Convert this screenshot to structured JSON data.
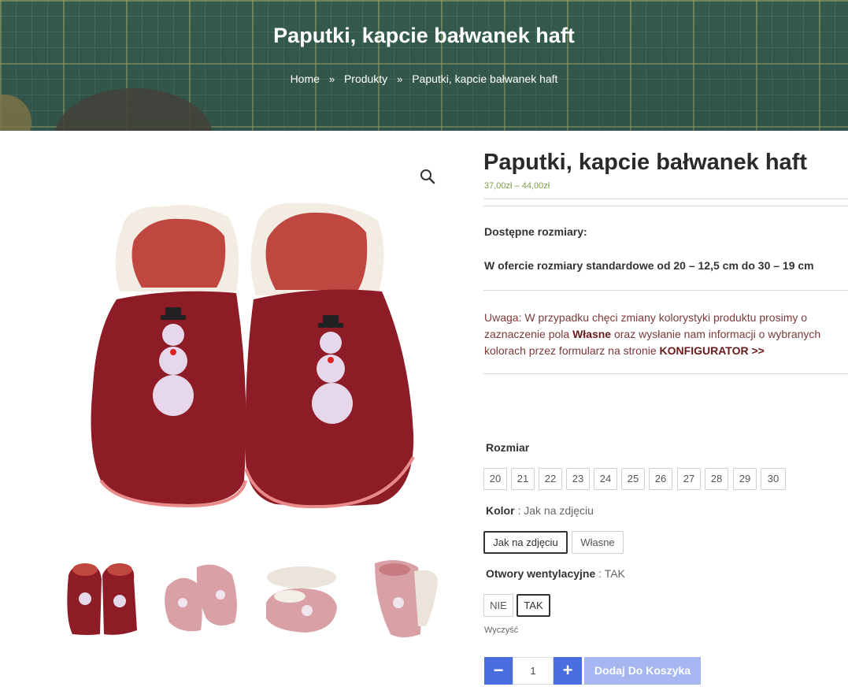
{
  "hero": {
    "title": "Paputki, kapcie bałwanek haft",
    "breadcrumb": [
      "Home",
      "Produkty",
      "Paputki, kapcie bałwanek haft"
    ]
  },
  "product": {
    "title": "Paputki, kapcie bałwanek haft",
    "price": "37,00zł – 44,00zł",
    "sizes_heading": "Dostępne rozmiary:",
    "sizes_desc": "W ofercie rozmiary standardowe od 20 – 12,5 cm do 30 – 19 cm",
    "note": {
      "part1": "Uwaga: W przypadku chęci zmiany kolorystyki produktu prosimy o zaznaczenie pola ",
      "strong1": "Własne",
      "part2": " oraz wysłanie nam informacji o wybranych kolorach przez formularz na stronie ",
      "strong2": "KONFIGURATOR >>"
    }
  },
  "variations": {
    "size_label": "Rozmiar",
    "sizes": [
      "20",
      "21",
      "22",
      "23",
      "24",
      "25",
      "26",
      "27",
      "28",
      "29",
      "30"
    ],
    "color_label": "Kolor",
    "color_selected": " : Jak na zdjęciu",
    "colors": [
      "Jak na zdjęciu",
      "Własne"
    ],
    "vent_label": "Otwory wentylacyjne",
    "vent_selected": " : TAK",
    "vents": [
      "NIE",
      "TAK"
    ],
    "clear": "Wyczyść"
  },
  "cart": {
    "minus": "−",
    "plus": "+",
    "qty": "1",
    "add_label": "Dodaj Do Koszyka"
  },
  "icons": {
    "zoom": "magnifier-icon"
  },
  "colors": {
    "accent_blue": "#4a6ee0",
    "price_green": "#7a9e4a",
    "shoe_red": "#8e1c26"
  }
}
